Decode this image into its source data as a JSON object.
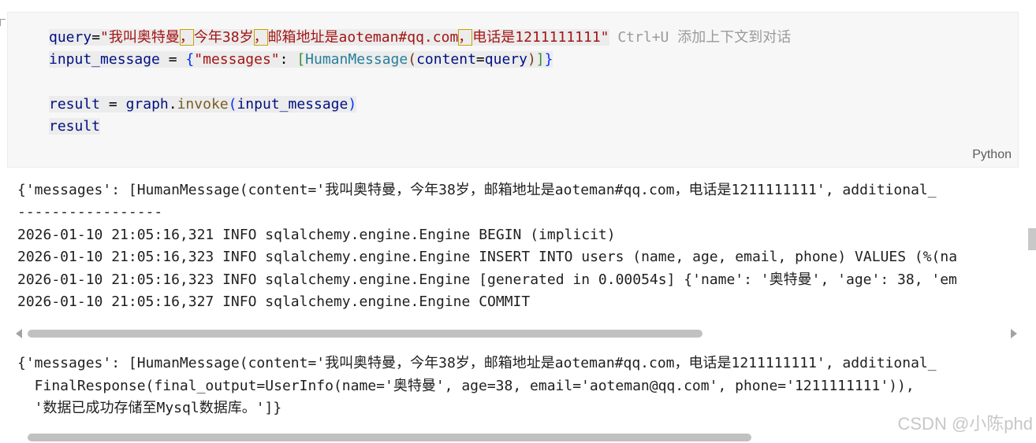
{
  "code": {
    "line1": {
      "var": "query",
      "eq": "=",
      "q_open": "\"",
      "s1": "我叫奥特曼",
      "c1": "，",
      "s2": "今年38岁",
      "c2": "，",
      "s3": "邮箱地址是aoteman#qq.com",
      "c3": "，",
      "s4": "电话是1211111111",
      "q_close": "\"",
      "hint_keys": "Ctrl+U",
      "hint_text": "添加上下文到对话"
    },
    "line2": {
      "var": "input_message",
      "eq": "=",
      "brace_open": "{",
      "key": "\"messages\"",
      "colon": ":",
      "br_open": "[",
      "cls": "HumanMessage",
      "paren_open": "(",
      "param": "content",
      "assign": "=",
      "arg": "query",
      "paren_close": ")",
      "br_close": "]",
      "brace_close": "}"
    },
    "line3": {
      "var": "result",
      "eq": "=",
      "obj": "graph",
      "dot": ".",
      "fn": "invoke",
      "paren_open": "(",
      "arg": "input_message",
      "paren_close": ")"
    },
    "line4": {
      "var": "result"
    },
    "language": "Python"
  },
  "output1": {
    "lines": [
      "{'messages': [HumanMessage(content='我叫奥特曼，今年38岁，邮箱地址是aoteman#qq.com，电话是1211111111', additional_",
      "-----------------",
      "2026-01-10 21:05:16,321 INFO sqlalchemy.engine.Engine BEGIN (implicit)",
      "2026-01-10 21:05:16,323 INFO sqlalchemy.engine.Engine INSERT INTO users (name, age, email, phone) VALUES (%(na",
      "2026-01-10 21:05:16,323 INFO sqlalchemy.engine.Engine [generated in 0.00054s] {'name': '奥特曼', 'age': 38, 'em",
      "2026-01-10 21:05:16,327 INFO sqlalchemy.engine.Engine COMMIT"
    ]
  },
  "output2": {
    "lines": [
      "{'messages': [HumanMessage(content='我叫奥特曼，今年38岁，邮箱地址是aoteman#qq.com，电话是1211111111', additional_",
      "  FinalResponse(final_output=UserInfo(name='奥特曼', age=38, email='aoteman@qq.com', phone='1211111111')),",
      "  '数据已成功存储至Mysql数据库。']}"
    ]
  },
  "scroll": {
    "output1_thumb_fraction": 0.69,
    "output2_thumb_fraction": 0.74
  },
  "watermark": "CSDN @小陈phd",
  "colors": {
    "variable": "#001080",
    "string": "#a31515",
    "class": "#267f99",
    "function": "#795e26",
    "hint": "#9a9a9a"
  }
}
